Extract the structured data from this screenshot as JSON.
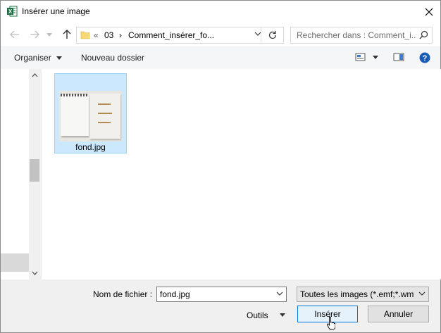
{
  "window": {
    "title": "Insérer une image",
    "app_icon": "excel-icon"
  },
  "address": {
    "overflow": "«",
    "crumbs": [
      "03",
      "Comment_insérer_fo..."
    ],
    "separator": "›"
  },
  "search": {
    "placeholder": "Rechercher dans : Comment_i..."
  },
  "toolbar": {
    "organize": "Organiser",
    "new_folder": "Nouveau dossier"
  },
  "files": [
    {
      "name": "fond.jpg",
      "selected": true
    }
  ],
  "bottom": {
    "filename_label": "Nom de fichier :",
    "filename_value": "fond.jpg",
    "filetype": "Toutes les images (*.emf;*.wmf",
    "tools": "Outils",
    "insert": "Insérer",
    "cancel": "Annuler"
  },
  "colors": {
    "selection": "#cce8ff",
    "accent": "#0078d7",
    "excel": "#1d6f42"
  }
}
